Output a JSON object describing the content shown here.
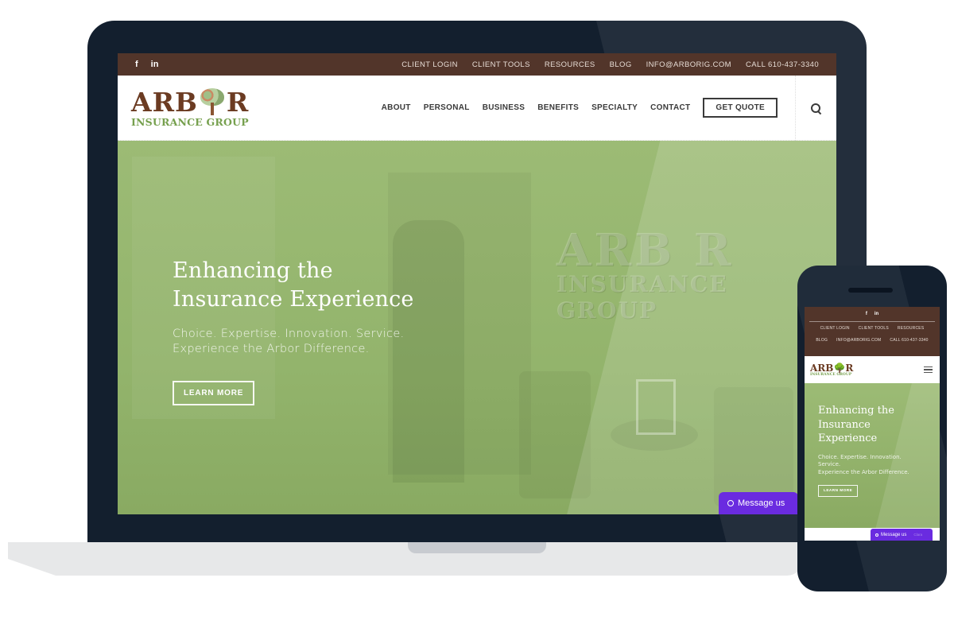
{
  "site": {
    "social": [
      {
        "name": "facebook",
        "glyph": "f"
      },
      {
        "name": "linkedin",
        "glyph": "in"
      }
    ],
    "utility_links": [
      "CLIENT LOGIN",
      "CLIENT TOOLS",
      "RESOURCES",
      "BLOG",
      "INFO@ARBORIG.COM",
      "CALL 610-437-3340"
    ],
    "logo": {
      "top_left": "ARB",
      "top_right": "R",
      "bottom": "INSURANCE GROUP"
    },
    "nav": [
      "ABOUT",
      "PERSONAL",
      "BUSINESS",
      "BENEFITS",
      "SPECIALTY",
      "CONTACT"
    ],
    "quote_button": "GET QUOTE",
    "search_icon": "search-icon",
    "hero": {
      "title_line1": "Enhancing the",
      "title_line2": "Insurance Experience",
      "subtitle_line1": "Choice. Expertise. Innovation. Service.",
      "subtitle_line2": "Experience the Arbor Difference.",
      "cta": "LEARN MORE",
      "wall_logo_top": "ARB  R",
      "wall_logo_bottom": "INSURANCE GROUP"
    },
    "messenger": {
      "label": "Message us"
    }
  },
  "mobile": {
    "hero": {
      "title_line1": "Enhancing the",
      "title_line2": "Insurance",
      "title_line3": "Experience",
      "subtitle_line1": "Choice. Expertise. Innovation.",
      "subtitle_line2": "Service.",
      "subtitle_line3": "Experience the Arbor Difference.",
      "cta": "LEARN MORE"
    },
    "messenger": {
      "label": "Message us",
      "dim_text": "Clara"
    }
  },
  "colors": {
    "utility_bar": "#52352a",
    "brand_brown": "#6b3b22",
    "brand_green": "#76a04e",
    "hero_green": "#93b46c",
    "messenger_purple": "#6a2be0",
    "device_frame": "#131f2e"
  }
}
